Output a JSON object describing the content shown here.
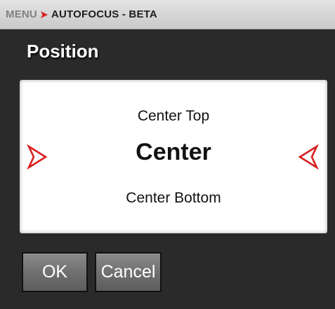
{
  "breadcrumb": {
    "root": "MENU",
    "current": "AUTOFOCUS - BETA"
  },
  "page_title": "Position",
  "picker": {
    "previous_option": "Center Top",
    "selected_option": "Center",
    "next_option": "Center Bottom"
  },
  "buttons": {
    "ok_label": "OK",
    "cancel_label": "Cancel"
  },
  "colors": {
    "accent_red": "#d81e1e",
    "background": "#2a2a2a",
    "header_bar": "#d6d6d6",
    "panel": "#ffffff"
  },
  "icons": {
    "breadcrumb_separator": "chevron-right-icon",
    "left_arrow": "arrow-outline-right-icon",
    "right_arrow": "arrow-outline-left-icon"
  }
}
